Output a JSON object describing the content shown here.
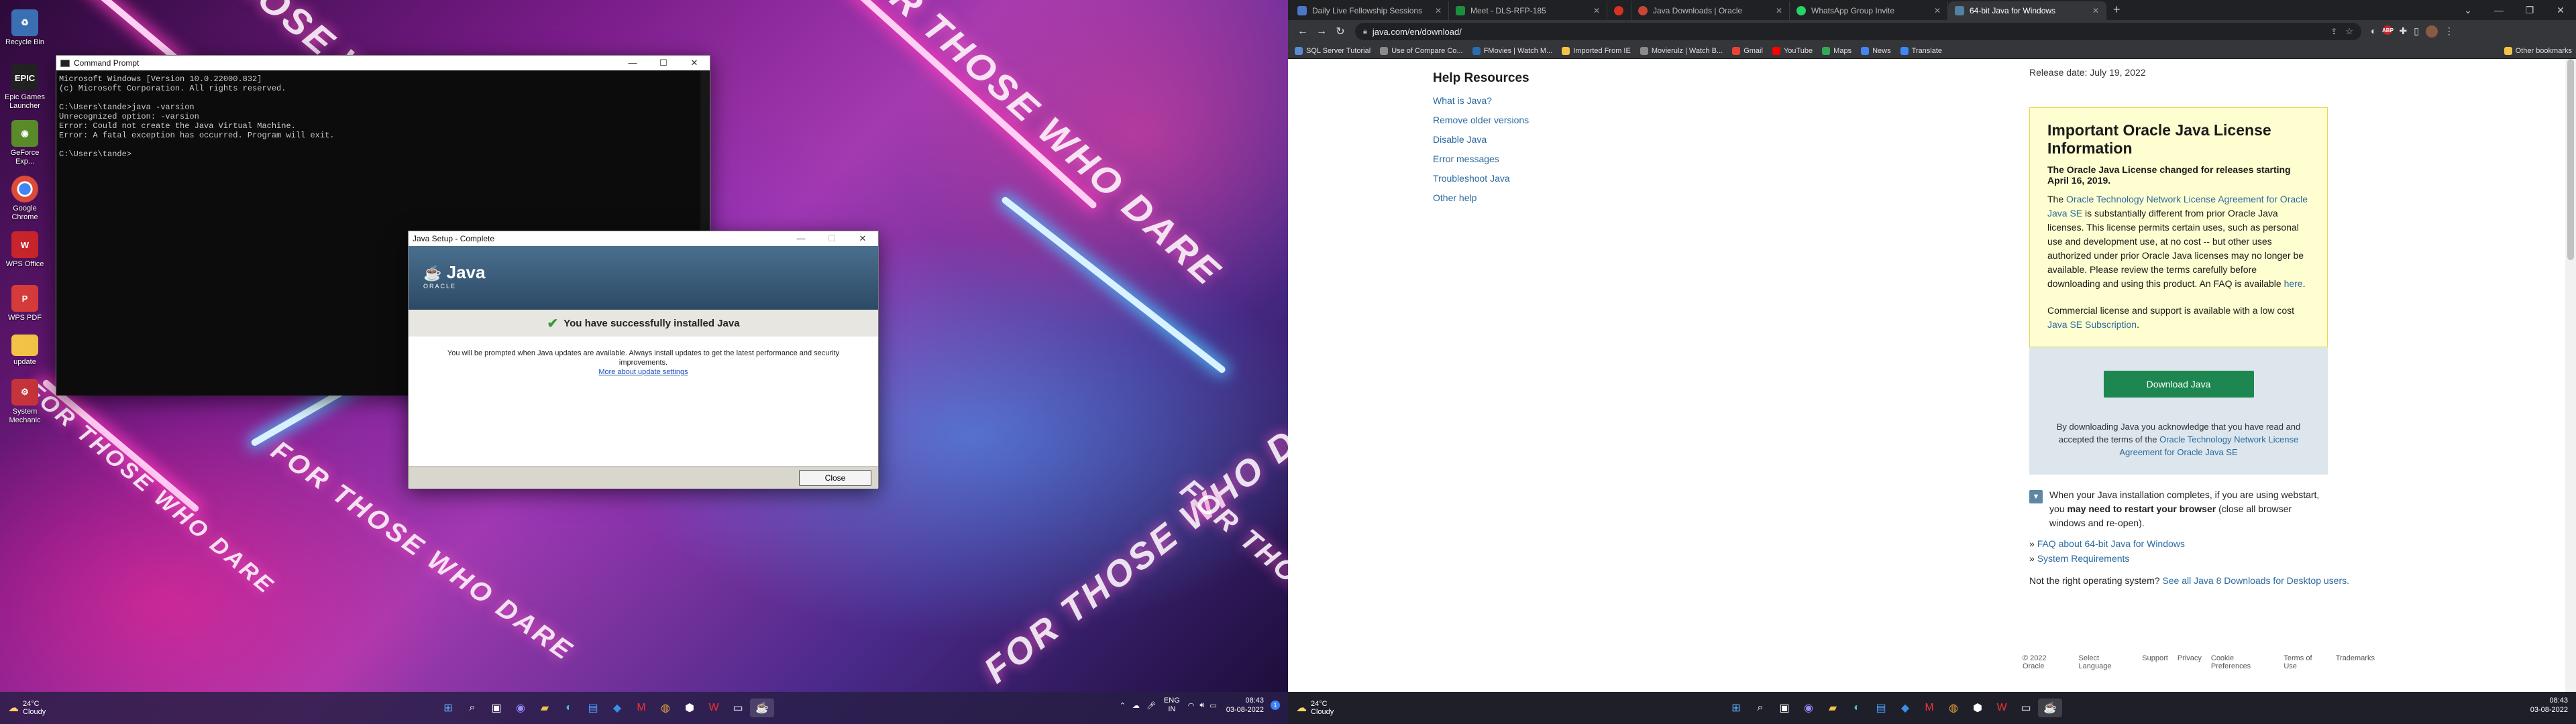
{
  "desktop": {
    "icons": [
      {
        "label": "Recycle Bin",
        "icon": "recycle-bin-icon",
        "color": "#3b6fb4"
      },
      {
        "label": "Epic Games Launcher",
        "icon": "epic-games-icon",
        "color": "#222222"
      },
      {
        "label": "GeForce Exp...",
        "icon": "geforce-icon",
        "color": "#5a8b2a"
      },
      {
        "label": "Google Chrome",
        "icon": "chrome-icon",
        "color": "#dd4b39"
      },
      {
        "label": "WPS Office",
        "icon": "wps-office-icon",
        "color": "#c8242b"
      },
      {
        "label": "WPS PDF",
        "icon": "wps-pdf-icon",
        "color": "#d63b3b"
      },
      {
        "label": "update",
        "icon": "folder-icon",
        "color": "#f2c347"
      },
      {
        "label": "System Mechanic",
        "icon": "system-mechanic-icon",
        "color": "#c4343a"
      }
    ],
    "slogans": [
      "FOR THOSE WHO DARE",
      "FOR THOSE WHO DARE",
      "FOR THOSE WHO DARE",
      "FOR THOSE WHO DARE",
      "FOR THOSE WHO DARE",
      "FOR THOSE WHO DARE"
    ]
  },
  "cmd": {
    "title": "Command Prompt",
    "lines": "Microsoft Windows [Version 10.0.22000.832]\n(c) Microsoft Corporation. All rights reserved.\n\nC:\\Users\\tande>java -varsion\nUnrecognized option: -varsion\nError: Could not create the Java Virtual Machine.\nError: A fatal exception has occurred. Program will exit.\n\nC:\\Users\\tande>"
  },
  "java_setup": {
    "title": "Java Setup - Complete",
    "logo": "Java",
    "logo_sub": "ORACLE",
    "heading": "You have successfully installed Java",
    "message": "You will be prompted when Java updates are available. Always install updates to get the latest performance and security improvements.",
    "link": "More about update settings",
    "close": "Close"
  },
  "taskbar1": {
    "temp": "24°C",
    "cond": "Cloudy",
    "lang": "ENG",
    "region": "IN",
    "time": "08:43",
    "date": "03-08-2022"
  },
  "browser": {
    "tabs": [
      {
        "label": "Daily Live Fellowship Sessions",
        "color": "#4a78c8"
      },
      {
        "label": "Meet - DLS-RFP-185",
        "color": "#1e8e3e"
      },
      {
        "label": "",
        "color": "#d93025"
      },
      {
        "label": "Java Downloads | Oracle",
        "color": "#c74634"
      },
      {
        "label": "WhatsApp Group Invite",
        "color": "#25d366"
      },
      {
        "label": "64-bit Java for Windows",
        "color": "#5382a1",
        "active": true
      }
    ],
    "url": "java.com/en/download/",
    "bookmarks": [
      {
        "label": "SQL Server Tutorial",
        "color": "#5a8bd0"
      },
      {
        "label": "Use of Compare Co...",
        "color": "#8a8a8a"
      },
      {
        "label": "FMovies | Watch M...",
        "color": "#2b6cb0"
      },
      {
        "label": "Imported From IE",
        "color": "#f2c347"
      },
      {
        "label": "Movierulz | Watch B...",
        "color": "#8a8a8a"
      },
      {
        "label": "Gmail",
        "color": "#ea4335"
      },
      {
        "label": "YouTube",
        "color": "#ff0000"
      },
      {
        "label": "Maps",
        "color": "#34a853"
      },
      {
        "label": "News",
        "color": "#4285f4"
      },
      {
        "label": "Translate",
        "color": "#4285f4"
      }
    ],
    "other_bookmarks": "Other bookmarks"
  },
  "page": {
    "help_title": "Help Resources",
    "help_links": [
      "What is Java?",
      "Remove older versions",
      "Disable Java",
      "Error messages",
      "Troubleshoot Java",
      "Other help"
    ],
    "release_date": "Release date: July 19, 2022",
    "license": {
      "title": "Important Oracle Java License Information",
      "subtitle": "The Oracle Java License changed for releases starting April 16, 2019.",
      "p1_pre": "The ",
      "p1_link": "Oracle Technology Network License Agreement for Oracle Java SE",
      "p1_post": " is substantially different from prior Oracle Java licenses. This license permits certain uses, such as personal use and development use, at no cost -- but other uses authorized under prior Oracle Java licenses may no longer be available. Please review the terms carefully before downloading and using this product. An FAQ is available ",
      "p1_here": "here",
      "p1_end": ".",
      "p2_pre": "Commercial license and support is available with a low cost ",
      "p2_link": "Java SE Subscription",
      "p2_end": "."
    },
    "download_button": "Download Java",
    "download_note_pre": "By downloading Java you acknowledge that you have read and accepted the terms of the ",
    "download_note_link": "Oracle Technology Network License Agreement for Oracle Java SE",
    "notice_pre": "When your Java installation completes, if you are using webstart, you ",
    "notice_bold": "may need to restart your browser",
    "notice_post": " (close all browser windows and re-open).",
    "faq_link": "FAQ about 64-bit Java for Windows",
    "sysreq_link": "System Requirements",
    "other_os_pre": "Not the right operating system? ",
    "other_os_link": "See all Java 8 Downloads for Desktop users.",
    "footer": [
      "© 2022 Oracle",
      "Select Language",
      "Support",
      "Privacy",
      "Cookie Preferences",
      "Terms of Use",
      "Trademarks"
    ]
  },
  "taskbar2": {
    "temp": "24°C",
    "cond": "Cloudy",
    "time": "08:43",
    "date": "03-08-2022"
  }
}
